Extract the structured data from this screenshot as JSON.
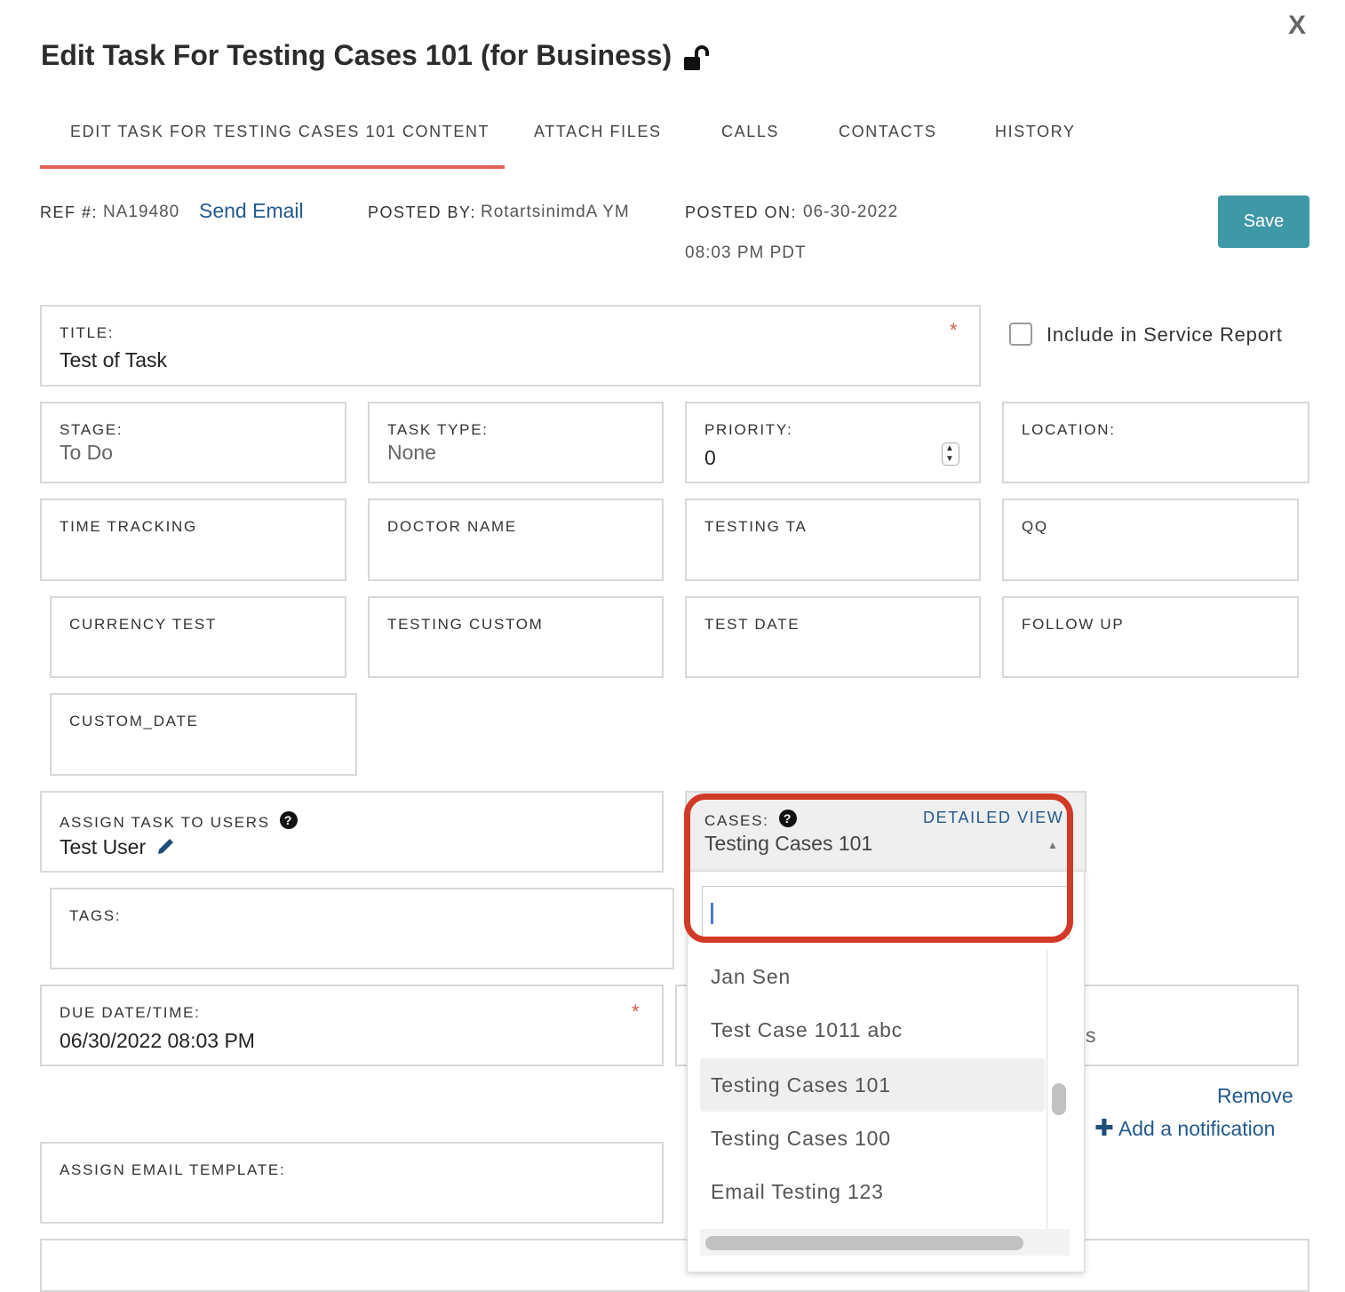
{
  "dialog": {
    "title": "Edit Task For Testing Cases 101 (for Business)",
    "close_label": "X"
  },
  "tabs": [
    {
      "label": "EDIT TASK FOR TESTING CASES 101 CONTENT",
      "active": true
    },
    {
      "label": "ATTACH FILES"
    },
    {
      "label": "CALLS"
    },
    {
      "label": "CONTACTS"
    },
    {
      "label": "HISTORY"
    }
  ],
  "meta": {
    "ref_label": "REF #:",
    "ref_value": "NA19480",
    "send_email": "Send Email",
    "posted_by_label": "POSTED BY:",
    "posted_by_value": "RotartsinimdA YM",
    "posted_on_label": "POSTED ON:",
    "posted_on_date": "06-30-2022",
    "posted_on_time": "08:03 PM PDT"
  },
  "save_label": "Save",
  "form": {
    "title_label": "TITLE:",
    "title_value": "Test of Task",
    "required_mark": "*",
    "include_report_label": "Include in Service Report",
    "stage_label": "STAGE:",
    "stage_value": "To Do",
    "task_type_label": "TASK TYPE:",
    "task_type_value": "None",
    "priority_label": "PRIORITY:",
    "priority_value": "0",
    "location_label": "LOCATION:",
    "time_tracking_label": "TIME TRACKING",
    "doctor_name_label": "DOCTOR NAME",
    "testing_ta_label": "TESTING TA",
    "qq_label": "QQ",
    "currency_test_label": "CURRENCY TEST",
    "testing_custom_label": "TESTING CUSTOM",
    "test_date_label": "TEST DATE",
    "follow_up_label": "FOLLOW UP",
    "custom_date_label": "CUSTOM_DATE",
    "assign_users_label": "ASSIGN TASK TO USERS",
    "assign_users_value": "Test User",
    "cases_label": "CASES:",
    "cases_detailed_view": "DETAILED VIEW",
    "cases_value": "Testing Cases 101",
    "tags_label": "TAGS:",
    "due_label": "DUE DATE/TIME:",
    "due_value": "06/30/2022 08:03 PM",
    "hidden_field_fragment": "s",
    "remove_label": "Remove",
    "add_notification_label": "Add a notification",
    "email_template_label": "ASSIGN EMAIL TEMPLATE:"
  },
  "cases_dropdown": {
    "search_value": "",
    "options": [
      {
        "label": "Jan Sen"
      },
      {
        "label": "Test Case 1011 abc"
      },
      {
        "label": "Testing Cases 101",
        "selected": true
      },
      {
        "label": "Testing Cases 100"
      },
      {
        "label": "Email Testing 123"
      }
    ]
  },
  "colors": {
    "accent_tab": "#e06555",
    "save_button": "#3f98a6",
    "link": "#245a8d",
    "highlight": "#d23a28",
    "required": "#e05a4b"
  }
}
